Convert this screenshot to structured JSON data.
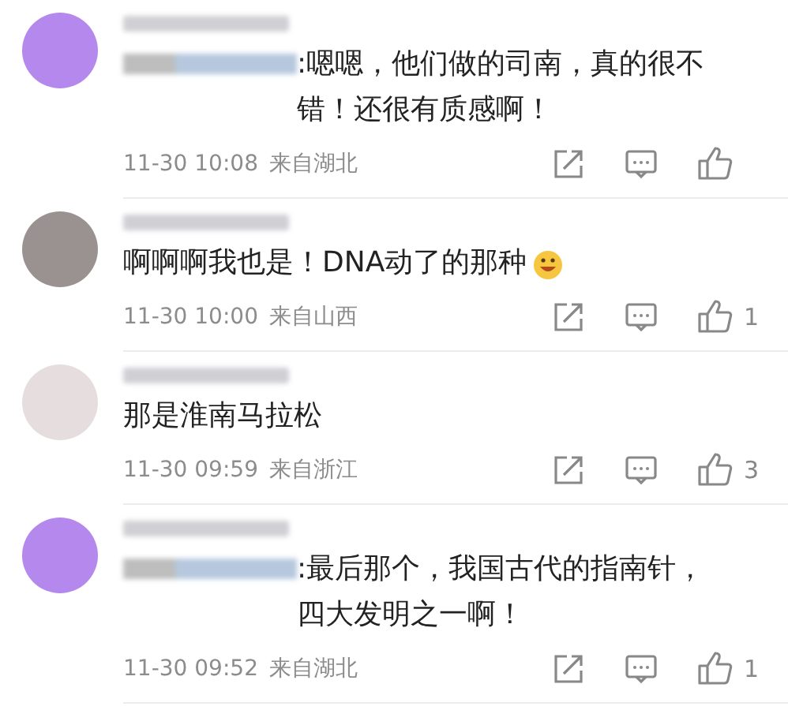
{
  "comments": [
    {
      "avatar": {
        "color": "#b488ec"
      },
      "mention": true,
      "text": ":嗯嗯，他们做的司南，真的很不错！还很有质感啊！",
      "emoji": false,
      "time": "11-30 10:08",
      "location": "来自湖北"
    },
    {
      "avatar": {
        "color": "#9a9290"
      },
      "mention": false,
      "text": "啊啊啊我也是！DNA动了的那种",
      "emoji": true,
      "time": "11-30 10:00",
      "location": "来自山西",
      "likes": "1"
    },
    {
      "avatar": {
        "color": "#e6dede"
      },
      "mention": false,
      "text": "那是淮南马拉松",
      "emoji": false,
      "time": "11-30 09:59",
      "location": "来自浙江",
      "likes": "3"
    },
    {
      "avatar": {
        "color": "#b488ec"
      },
      "mention": true,
      "text": ":最后那个，我国古代的指南针，四大发明之一啊！",
      "emoji": false,
      "time": "11-30 09:52",
      "location": "来自湖北",
      "likes": "1"
    }
  ]
}
